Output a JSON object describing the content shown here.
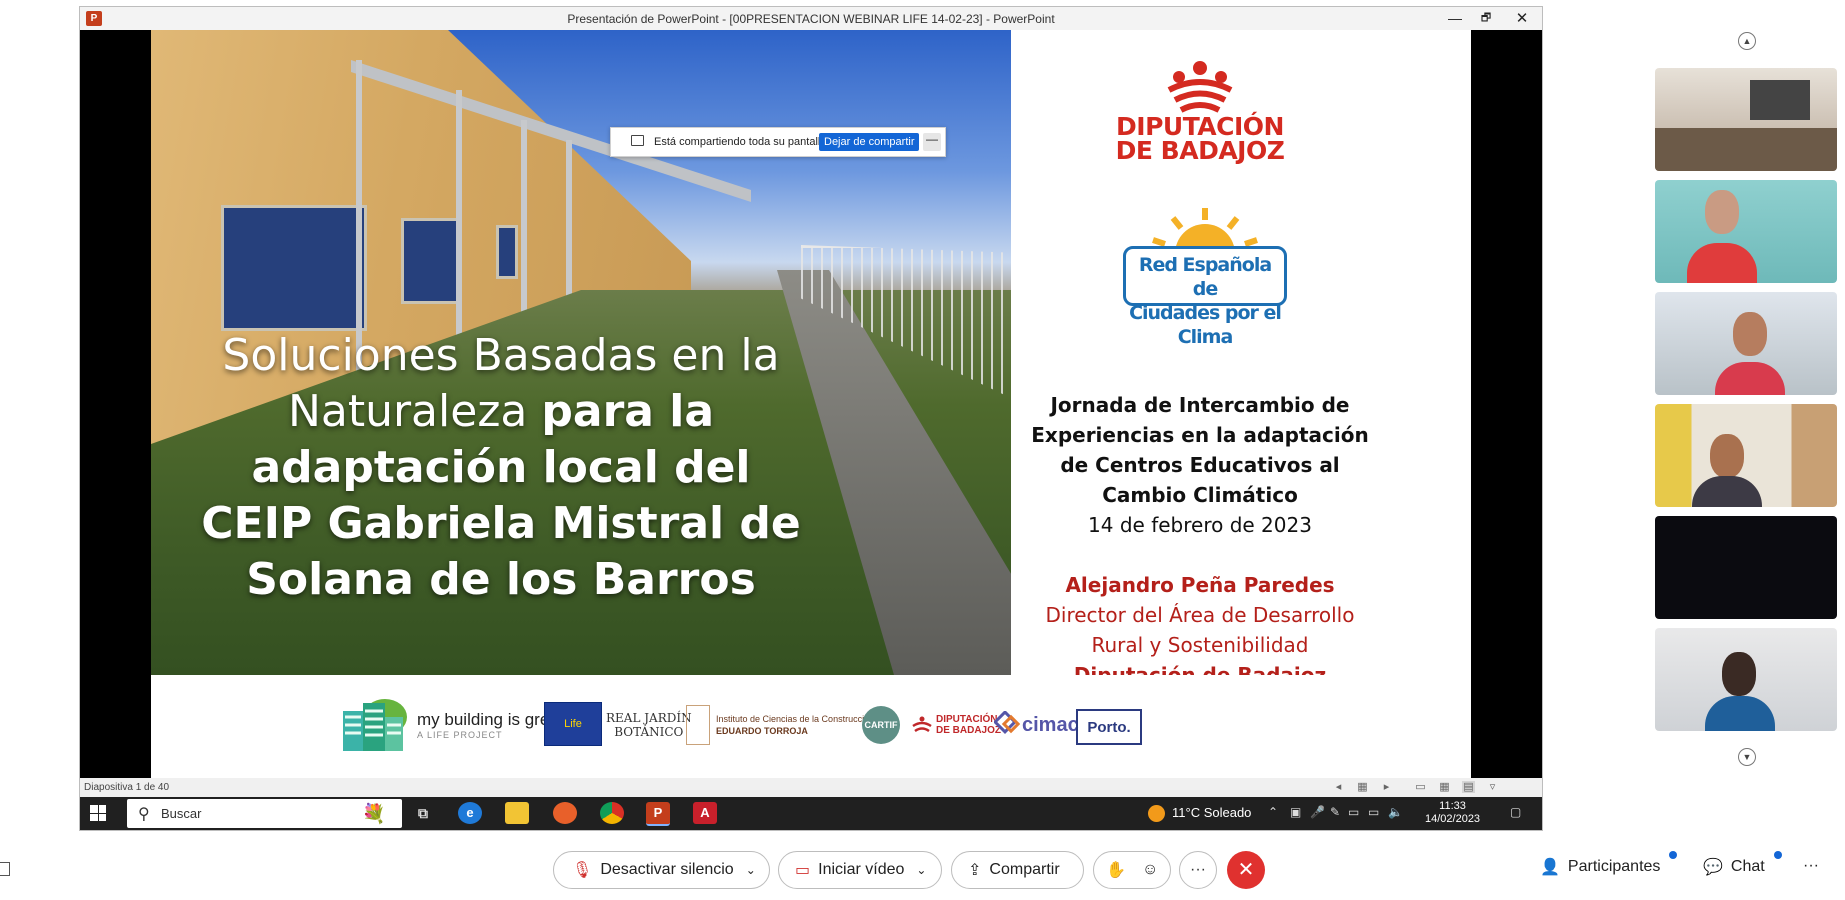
{
  "window": {
    "title": "Presentación de PowerPoint - [00PRESENTACION WEBINAR LIFE 14-02-23] - PowerPoint",
    "app_icon": "P",
    "controls": {
      "minimize": "—",
      "restore": "🗗",
      "close": "✕"
    }
  },
  "share_bar": {
    "text": "Está compartiendo toda su pantalla.",
    "stop_label": "Dejar de compartir",
    "minimize": "—"
  },
  "slide": {
    "headline_light": "Soluciones Basadas en la Naturaleza ",
    "headline_bold": "para la adaptación local del CEIP Gabriela Mistral de Solana de los Barros",
    "logo_line1": "DIPUTACIÓN",
    "logo_line2": "DE BADAJOZ",
    "red_line1": "Red Española de",
    "red_line2": "Ciudades por el Clima",
    "event_title": "Jornada de Intercambio de Experiencias en la adaptación de Centros Educativos al Cambio Climático",
    "event_date": "14 de febrero de 2023",
    "speaker_name": "Alejandro Peña Paredes",
    "speaker_role": "Director del Área de Desarrollo Rural y Sostenibilidad",
    "speaker_org": "Diputación de Badajoz",
    "sponsors": {
      "mybuilding": "my building is green",
      "mybuilding_sub": "A LIFE PROJECT",
      "life": "Life",
      "rjb_line1": "REAL JARDÍN",
      "rjb_line2": "BOTÁNICO",
      "ietcc_line1": "Instituto de Ciencias de la Construcción",
      "ietcc_line2": "EDUARDO TORROJA",
      "cartif": "CARTIF",
      "dipu_line1": "DIPUTACIÓN",
      "dipu_line2": "DE BADAJOZ",
      "cimac": "cimac",
      "porto": "Porto."
    }
  },
  "statusbar": {
    "slide_counter": "Diapositiva 1 de 40"
  },
  "taskbar": {
    "search_label": "Buscar",
    "weather": "11°C  Soleado",
    "time": "11:33",
    "date": "14/02/2023"
  },
  "meeting_controls": {
    "mute_label": "Desactivar silencio",
    "video_label": "Iniciar vídeo",
    "share_label": "Compartir",
    "participants_label": "Participantes",
    "chat_label": "Chat",
    "more": "···"
  },
  "colors": {
    "brand_red": "#d42a20",
    "red_blue": "#1d6fb3",
    "speaker_red": "#b4201a",
    "leave_red": "#e0312f",
    "accent_blue": "#1366d6"
  }
}
